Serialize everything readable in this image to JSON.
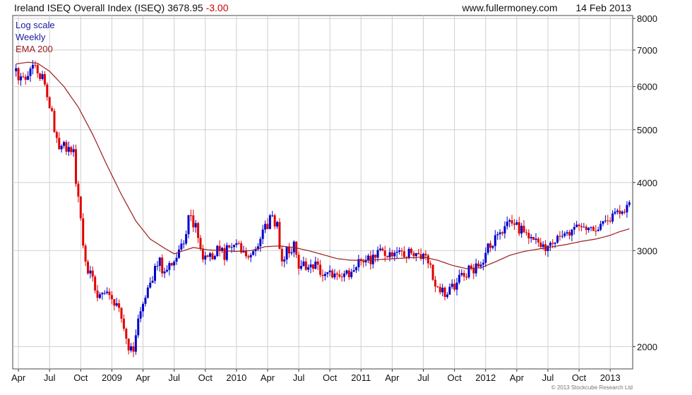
{
  "header": {
    "title": "Ireland ISEQ Overall Index (ISEQ)",
    "price": "3678.95",
    "change": "-3.00",
    "website": "www.fullermoney.com",
    "date": "14 Feb 2013"
  },
  "legend": {
    "scale": "Log scale",
    "frequency": "Weekly",
    "indicator": "EMA 200"
  },
  "footer": {
    "copyright": "© 2013 Stockcube Research Ltd"
  },
  "colors": {
    "up": "#0000cc",
    "down": "#e00000",
    "ema": "#9b1c1c",
    "grid": "#cfcfcf",
    "axis": "#333333",
    "legend_text": "#1a1aa0",
    "legend_ema": "#9b1c1c"
  },
  "chart_data": {
    "type": "candlestick",
    "scale": "log",
    "frequency": "weekly",
    "grid": true,
    "ylim": [
      1820,
      8100
    ],
    "y_ticks": [
      2000,
      3000,
      4000,
      5000,
      6000,
      7000,
      8000
    ],
    "x_ticks": [
      {
        "label": "Apr",
        "t": 1.5
      },
      {
        "label": "Jul",
        "t": 14.5
      },
      {
        "label": "Oct",
        "t": 27.5
      },
      {
        "label": "2009",
        "t": 40.5
      },
      {
        "label": "Apr",
        "t": 53.5
      },
      {
        "label": "Jul",
        "t": 66.5
      },
      {
        "label": "Oct",
        "t": 79.5
      },
      {
        "label": "2010",
        "t": 92.5
      },
      {
        "label": "Apr",
        "t": 105.5
      },
      {
        "label": "Jul",
        "t": 118.5
      },
      {
        "label": "Oct",
        "t": 131.5
      },
      {
        "label": "2011",
        "t": 144.5
      },
      {
        "label": "Apr",
        "t": 157.5
      },
      {
        "label": "Jul",
        "t": 170.5
      },
      {
        "label": "Oct",
        "t": 183.5
      },
      {
        "label": "2012",
        "t": 196.5
      },
      {
        "label": "Apr",
        "t": 209.5
      },
      {
        "label": "Jul",
        "t": 222.5
      },
      {
        "label": "Oct",
        "t": 235.5
      },
      {
        "label": "2013",
        "t": 248.5
      }
    ],
    "weeks_total": 257,
    "close_anchors": [
      [
        0,
        6400
      ],
      [
        3,
        6150
      ],
      [
        6,
        6450
      ],
      [
        9,
        6500
      ],
      [
        10,
        6300
      ],
      [
        12,
        6100
      ],
      [
        14,
        5600
      ],
      [
        16,
        5000
      ],
      [
        18,
        4600
      ],
      [
        20,
        4700
      ],
      [
        24,
        4500
      ],
      [
        26,
        3700
      ],
      [
        29,
        2800
      ],
      [
        31,
        2750
      ],
      [
        34,
        2450
      ],
      [
        36,
        2550
      ],
      [
        40,
        2450
      ],
      [
        43,
        2300
      ],
      [
        47,
        1950
      ],
      [
        49,
        2000
      ],
      [
        51,
        2200
      ],
      [
        54,
        2500
      ],
      [
        57,
        2700
      ],
      [
        60,
        2850
      ],
      [
        62,
        2700
      ],
      [
        64,
        2850
      ],
      [
        67,
        2950
      ],
      [
        70,
        3050
      ],
      [
        72,
        3450
      ],
      [
        75,
        3350
      ],
      [
        78,
        2950
      ],
      [
        81,
        2950
      ],
      [
        84,
        3000
      ],
      [
        87,
        2950
      ],
      [
        90,
        3100
      ],
      [
        94,
        3000
      ],
      [
        97,
        2950
      ],
      [
        100,
        3000
      ],
      [
        103,
        3200
      ],
      [
        106,
        3450
      ],
      [
        109,
        3350
      ],
      [
        111,
        2850
      ],
      [
        113,
        3000
      ],
      [
        116,
        3050
      ],
      [
        118,
        2850
      ],
      [
        121,
        2800
      ],
      [
        124,
        2850
      ],
      [
        127,
        2750
      ],
      [
        130,
        2700
      ],
      [
        133,
        2700
      ],
      [
        136,
        2750
      ],
      [
        139,
        2700
      ],
      [
        142,
        2850
      ],
      [
        145,
        2900
      ],
      [
        148,
        2900
      ],
      [
        151,
        3000
      ],
      [
        154,
        2950
      ],
      [
        157,
        2900
      ],
      [
        160,
        3000
      ],
      [
        163,
        2950
      ],
      [
        166,
        3000
      ],
      [
        169,
        2950
      ],
      [
        172,
        2900
      ],
      [
        174,
        2650
      ],
      [
        177,
        2550
      ],
      [
        180,
        2500
      ],
      [
        183,
        2600
      ],
      [
        186,
        2700
      ],
      [
        189,
        2750
      ],
      [
        192,
        2800
      ],
      [
        195,
        2900
      ],
      [
        198,
        3100
      ],
      [
        201,
        3200
      ],
      [
        204,
        3300
      ],
      [
        207,
        3350
      ],
      [
        210,
        3300
      ],
      [
        213,
        3250
      ],
      [
        216,
        3150
      ],
      [
        219,
        3100
      ],
      [
        222,
        3050
      ],
      [
        225,
        3150
      ],
      [
        228,
        3200
      ],
      [
        231,
        3250
      ],
      [
        234,
        3300
      ],
      [
        237,
        3300
      ],
      [
        240,
        3250
      ],
      [
        243,
        3300
      ],
      [
        246,
        3400
      ],
      [
        249,
        3500
      ],
      [
        252,
        3550
      ],
      [
        254,
        3600
      ],
      [
        256,
        3680
      ]
    ],
    "ema200_anchors": [
      [
        0,
        6600
      ],
      [
        5,
        6650
      ],
      [
        9,
        6620
      ],
      [
        14,
        6400
      ],
      [
        20,
        6000
      ],
      [
        26,
        5500
      ],
      [
        32,
        4900
      ],
      [
        38,
        4300
      ],
      [
        44,
        3800
      ],
      [
        50,
        3400
      ],
      [
        56,
        3150
      ],
      [
        62,
        3030
      ],
      [
        66,
        2960
      ],
      [
        70,
        3000
      ],
      [
        74,
        3040
      ],
      [
        80,
        3010
      ],
      [
        86,
        3000
      ],
      [
        92,
        2990
      ],
      [
        98,
        3000
      ],
      [
        104,
        3050
      ],
      [
        110,
        3060
      ],
      [
        116,
        3040
      ],
      [
        122,
        3000
      ],
      [
        128,
        2950
      ],
      [
        134,
        2900
      ],
      [
        140,
        2880
      ],
      [
        146,
        2880
      ],
      [
        152,
        2890
      ],
      [
        158,
        2900
      ],
      [
        164,
        2910
      ],
      [
        170,
        2920
      ],
      [
        176,
        2880
      ],
      [
        182,
        2820
      ],
      [
        188,
        2780
      ],
      [
        194,
        2790
      ],
      [
        200,
        2860
      ],
      [
        206,
        2940
      ],
      [
        212,
        2990
      ],
      [
        218,
        3020
      ],
      [
        224,
        3050
      ],
      [
        230,
        3080
      ],
      [
        236,
        3120
      ],
      [
        242,
        3150
      ],
      [
        248,
        3200
      ],
      [
        252,
        3250
      ],
      [
        256,
        3290
      ]
    ]
  }
}
